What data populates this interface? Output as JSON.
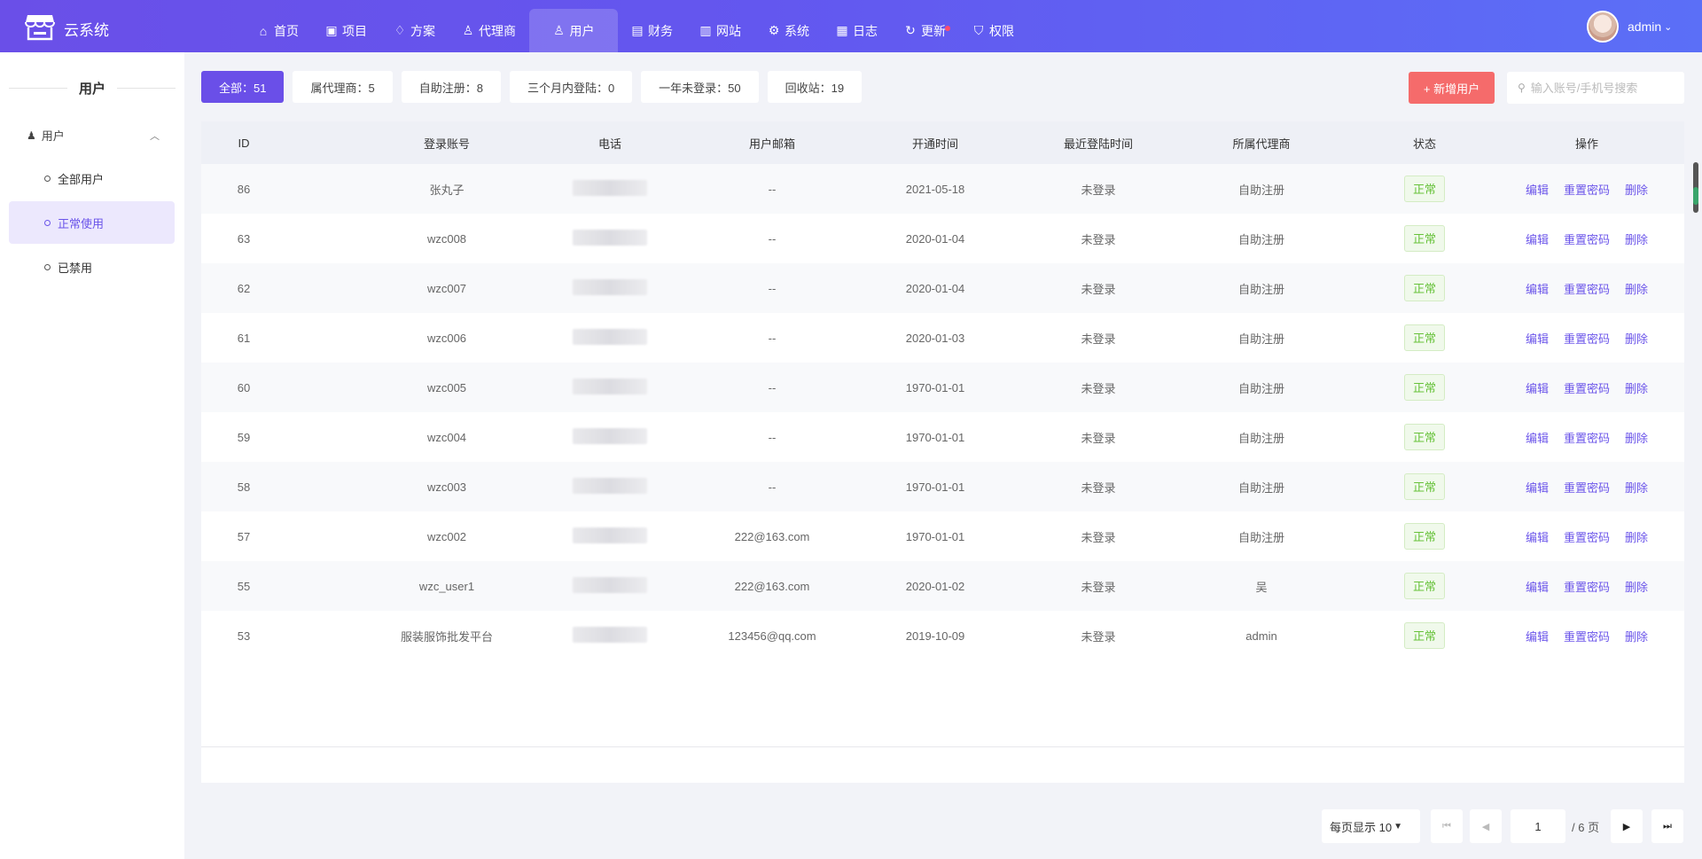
{
  "app": {
    "title": "云系统"
  },
  "nav": [
    {
      "label": "首页",
      "icon": "home-icon"
    },
    {
      "label": "项目",
      "icon": "briefcase-icon"
    },
    {
      "label": "方案",
      "icon": "diamond-icon"
    },
    {
      "label": "代理商",
      "icon": "user-icon"
    },
    {
      "label": "用户",
      "icon": "users-icon",
      "active": true
    },
    {
      "label": "财务",
      "icon": "wallet-icon"
    },
    {
      "label": "网站",
      "icon": "browser-icon"
    },
    {
      "label": "系统",
      "icon": "gear-icon"
    },
    {
      "label": "日志",
      "icon": "log-icon"
    },
    {
      "label": "更新",
      "icon": "refresh-icon",
      "badge": true
    },
    {
      "label": "权限",
      "icon": "shield-icon"
    }
  ],
  "user": {
    "name": "admin"
  },
  "sidebar": {
    "title": "用户",
    "group": "用户",
    "items": [
      {
        "label": "全部用户"
      },
      {
        "label": "正常使用"
      },
      {
        "label": "已禁用"
      }
    ]
  },
  "filters": [
    {
      "label": "全部：51"
    },
    {
      "label": "属代理商：5"
    },
    {
      "label": "自助注册：8"
    },
    {
      "label": "三个月内登陆：0"
    },
    {
      "label": "一年未登录：50"
    },
    {
      "label": "回收站：19"
    }
  ],
  "toolbar": {
    "add_label": "+ 新增用户",
    "search_placeholder": "输入账号/手机号搜索"
  },
  "table": {
    "headers": [
      "ID",
      "登录账号",
      "电话",
      "用户邮箱",
      "开通时间",
      "最近登陆时间",
      "所属代理商",
      "状态",
      "操作"
    ],
    "rows": [
      [
        "86",
        "张丸子",
        "--",
        "2021-05-18",
        "未登录",
        "自助注册",
        "正常"
      ],
      [
        "63",
        "wzc008",
        "--",
        "2020-01-04",
        "未登录",
        "自助注册",
        "正常"
      ],
      [
        "62",
        "wzc007",
        "--",
        "2020-01-04",
        "未登录",
        "自助注册",
        "正常"
      ],
      [
        "61",
        "wzc006",
        "--",
        "2020-01-03",
        "未登录",
        "自助注册",
        "正常"
      ],
      [
        "60",
        "wzc005",
        "--",
        "1970-01-01",
        "未登录",
        "自助注册",
        "正常"
      ],
      [
        "59",
        "wzc004",
        "--",
        "1970-01-01",
        "未登录",
        "自助注册",
        "正常"
      ],
      [
        "58",
        "wzc003",
        "--",
        "1970-01-01",
        "未登录",
        "自助注册",
        "正常"
      ],
      [
        "57",
        "wzc002",
        "222@163.com",
        "1970-01-01",
        "未登录",
        "自助注册",
        "正常"
      ],
      [
        "55",
        "wzc_user1",
        "222@163.com",
        "2020-01-02",
        "未登录",
        "吴",
        "正常"
      ],
      [
        "53",
        "服装服饰批发平台",
        "123456@qq.com",
        "2019-10-09",
        "未登录",
        "admin",
        "正常"
      ]
    ],
    "actions": [
      "编辑",
      "重置密码",
      "删除"
    ]
  },
  "pagination": {
    "page_size_label": "每页显示 10",
    "current": "1",
    "total_label": "/ 6 页"
  }
}
